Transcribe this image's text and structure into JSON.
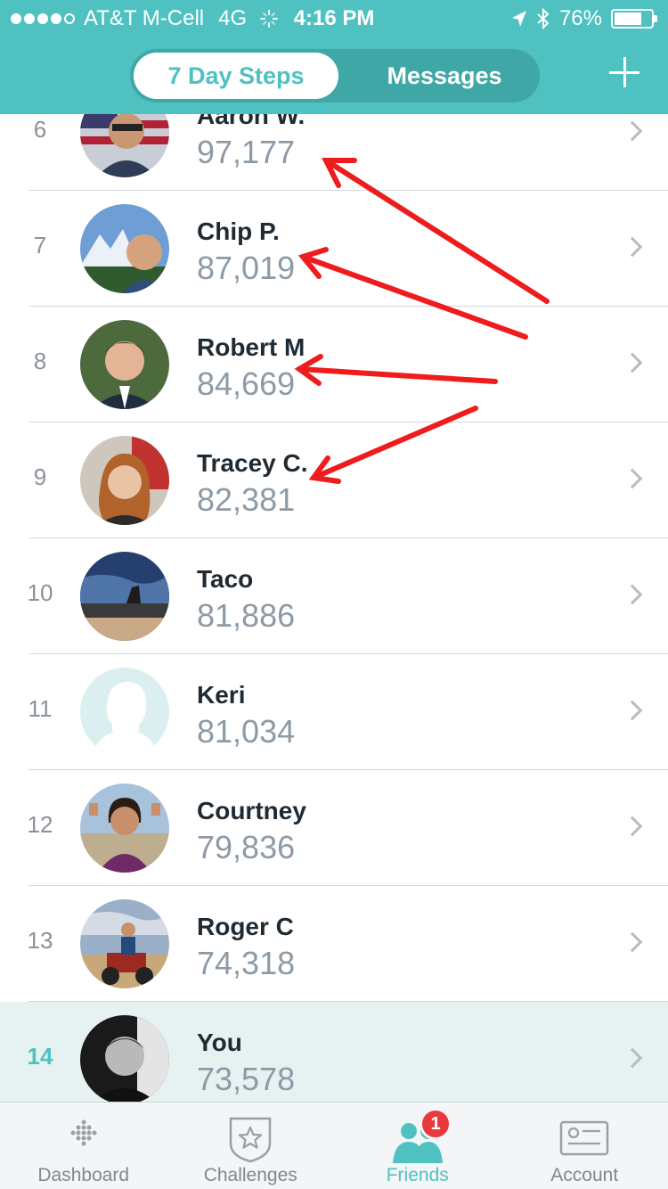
{
  "status_bar": {
    "carrier": "AT&T M-Cell",
    "network": "4G",
    "time": "4:16 PM",
    "battery_percent": "76%",
    "battery_level": 0.76
  },
  "header": {
    "segments": [
      "7 Day Steps",
      "Messages"
    ],
    "selected_segment": "7 Day Steps",
    "accent_color": "#4fc1c0"
  },
  "leaderboard": [
    {
      "rank": "6",
      "name": "Aaron W.",
      "steps": "97,177",
      "avatar": "avatar-flag-sunglasses"
    },
    {
      "rank": "7",
      "name": "Chip P.",
      "steps": "87,019",
      "avatar": "avatar-mountain-selfie"
    },
    {
      "rank": "8",
      "name": "Robert M",
      "steps": "84,669",
      "avatar": "avatar-suit-portrait"
    },
    {
      "rank": "9",
      "name": "Tracey C.",
      "steps": "82,381",
      "avatar": "avatar-woman-portrait"
    },
    {
      "rank": "10",
      "name": "Taco",
      "steps": "81,886",
      "avatar": "avatar-landscape"
    },
    {
      "rank": "11",
      "name": "Keri",
      "steps": "81,034",
      "avatar": "avatar-placeholder-silhouette"
    },
    {
      "rank": "12",
      "name": "Courtney",
      "steps": "79,836",
      "avatar": "avatar-woman-beach"
    },
    {
      "rank": "13",
      "name": "Roger C",
      "steps": "74,318",
      "avatar": "avatar-dune-buggy"
    },
    {
      "rank": "14",
      "name": "You",
      "steps": "73,578",
      "avatar": "avatar-self-bw",
      "is_current_user": true
    }
  ],
  "annotations": {
    "arrow_color": "#ee1c1c",
    "arrow_count": 4
  },
  "tab_bar": {
    "tabs": [
      {
        "label": "Dashboard",
        "icon": "fitbit-dots-icon"
      },
      {
        "label": "Challenges",
        "icon": "star-badge-icon"
      },
      {
        "label": "Friends",
        "icon": "friends-icon",
        "badge": "1"
      },
      {
        "label": "Account",
        "icon": "id-card-icon"
      }
    ],
    "selected": "Friends"
  }
}
